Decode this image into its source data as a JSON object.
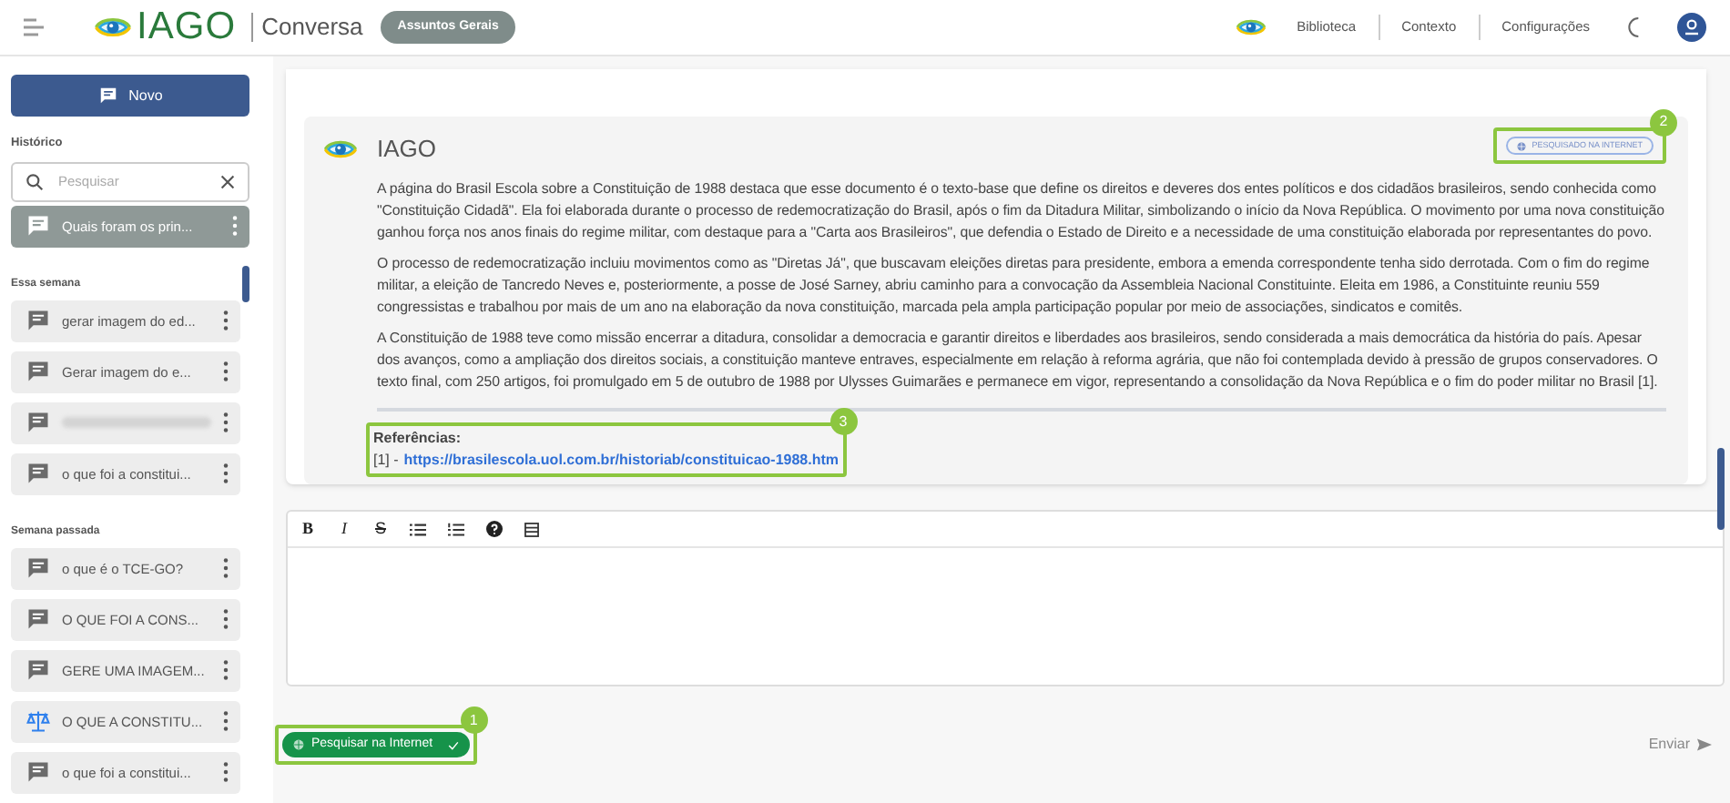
{
  "header": {
    "brand": "IAGO",
    "section": "Conversa",
    "chip": "Assuntos Gerais",
    "nav": [
      "Biblioteca",
      "Contexto",
      "Configurações"
    ]
  },
  "sidebar": {
    "new_button": "Novo",
    "history_label": "Histórico",
    "search": {
      "placeholder": "Pesquisar"
    },
    "groups": [
      {
        "items": [
          {
            "kind": "chat",
            "text": "Quais foram os prin...",
            "selected": true
          }
        ]
      },
      {
        "title": "Essa semana",
        "items": [
          {
            "kind": "chat",
            "text": "gerar imagem do ed...",
            "selected": false
          },
          {
            "kind": "chat",
            "text": "Gerar imagem do e...",
            "selected": false
          },
          {
            "kind": "redacted",
            "selected": false
          },
          {
            "kind": "chat",
            "text": "o que foi a constitui...",
            "selected": false
          }
        ]
      },
      {
        "title": "Semana passada",
        "items": [
          {
            "kind": "chat",
            "text": "o que é o TCE-GO?",
            "selected": false
          },
          {
            "kind": "chat",
            "text": "O QUE FOI A CONS...",
            "selected": false
          },
          {
            "kind": "chat",
            "text": "GERE UMA IMAGEM...",
            "selected": false
          },
          {
            "kind": "scale",
            "text": "O QUE A CONSTITU...",
            "selected": false
          },
          {
            "kind": "chat",
            "text": "o que foi a constitui...",
            "selected": false
          }
        ]
      }
    ]
  },
  "message": {
    "author": "IAGO",
    "badge": "PESQUISADO NA INTERNET",
    "paragraphs": [
      "A página do Brasil Escola sobre a Constituição de 1988 destaca que esse documento é o texto-base que define os direitos e deveres dos entes políticos e dos cidadãos brasileiros, sendo conhecida como \"Constituição Cidadã\". Ela foi elaborada durante o processo de redemocratização do Brasil, após o fim da Ditadura Militar, simbolizando o início da Nova República. O movimento por uma nova constituição ganhou força nos anos finais do regime militar, com destaque para a \"Carta aos Brasileiros\", que defendia o Estado de Direito e a necessidade de uma constituição elaborada por representantes do povo.",
      "O processo de redemocratização incluiu movimentos como as \"Diretas Já\", que buscavam eleições diretas para presidente, embora a emenda correspondente tenha sido derrotada. Com o fim do regime militar, a eleição de Tancredo Neves e, posteriormente, a posse de José Sarney, abriu caminho para a convocação da Assembleia Nacional Constituinte. Eleita em 1986, a Constituinte reuniu 559 congressistas e trabalhou por mais de um ano na elaboração da nova constituição, marcada pela ampla participação popular por meio de associações, sindicatos e comitês.",
      "A Constituição de 1988 teve como missão encerrar a ditadura, consolidar a democracia e garantir direitos e liberdades aos brasileiros, sendo considerada a mais democrática da história do país. Apesar dos avanços, como a ampliação dos direitos sociais, a constituição manteve entraves, especialmente em relação à reforma agrária, que não foi contemplada devido à pressão de grupos conservadores. O texto final, com 250 artigos, foi promulgado em 5 de outubro de 1988 por Ulysses Guimarães e permanece em vigor, representando a consolidação da Nova República e o fim do poder militar no Brasil [1]."
    ],
    "references_title": "Referências:",
    "references": [
      {
        "prefix": "[1] -",
        "url": "https://brasilescola.uol.com.br/historiab/constituicao-1988.htm"
      }
    ]
  },
  "editor": {
    "toolbar": [
      {
        "kind": "bold",
        "label": "B"
      },
      {
        "kind": "italic",
        "label": "I"
      },
      {
        "kind": "strike",
        "label": "S"
      },
      {
        "kind": "bullets"
      },
      {
        "kind": "numbers"
      },
      {
        "kind": "help"
      },
      {
        "kind": "table"
      }
    ]
  },
  "footer": {
    "internet_toggle": {
      "label": "Pesquisar na Internet",
      "on": true
    },
    "send": "Enviar"
  },
  "callouts": [
    "1",
    "2",
    "3"
  ]
}
